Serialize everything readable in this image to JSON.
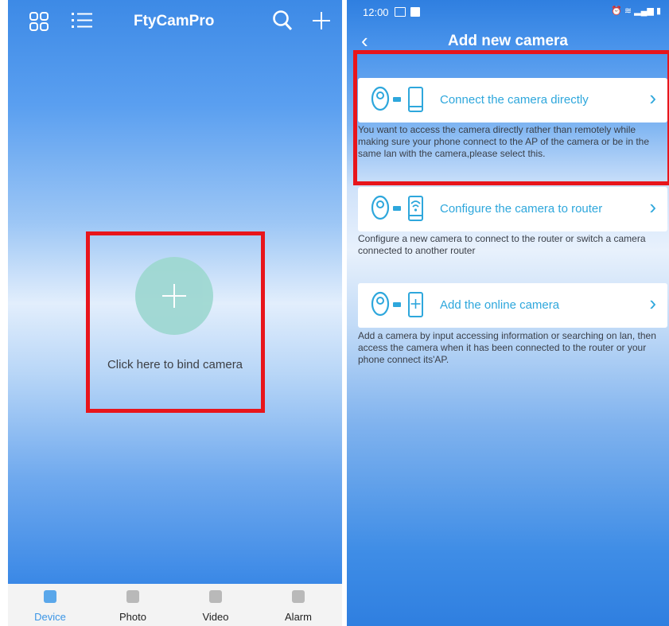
{
  "left": {
    "title": "FtyCamPro",
    "bind_label": "Click here to bind camera",
    "tabs": [
      {
        "label": "Device",
        "icon": "device-icon",
        "active": true
      },
      {
        "label": "Photo",
        "icon": "photo-icon",
        "active": false
      },
      {
        "label": "Video",
        "icon": "video-icon",
        "active": false
      },
      {
        "label": "Alarm",
        "icon": "alarm-icon",
        "active": false
      }
    ]
  },
  "right": {
    "time": "12:00",
    "title": "Add new camera",
    "options": [
      {
        "label": "Connect the camera directly",
        "description": "You want to access the camera directly rather than remotely while making sure your phone connect to the AP of the camera or be in the same lan with the camera,please select this.",
        "icon": "camera-phone-icon"
      },
      {
        "label": "Configure the camera to router",
        "description": "Configure a new camera to connect to the router or switch a camera connected to another router",
        "icon": "camera-wifi-icon"
      },
      {
        "label": "Add the online camera",
        "description": "Add a camera by input accessing information or searching on lan, then access the camera when it has been connected to the router or your phone connect its'AP.",
        "icon": "camera-add-icon"
      }
    ]
  },
  "colors": {
    "accent": "#2ea7dc",
    "highlight": "#e8151b",
    "tab_active": "#3a95e6"
  }
}
